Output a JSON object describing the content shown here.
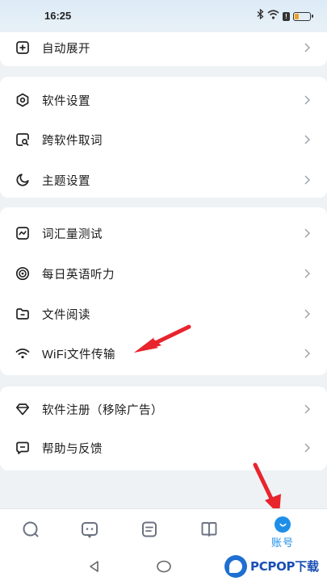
{
  "status_bar": {
    "time": "16:25",
    "icons": [
      "bluetooth-icon",
      "wifi-icon",
      "alert-icon",
      "battery-icon"
    ],
    "alert_glyph": "!",
    "battery_level": 0.25
  },
  "menu": {
    "group1": [
      {
        "label": "自动展开",
        "icon": "plus-square-icon"
      }
    ],
    "group2": [
      {
        "label": "软件设置",
        "icon": "hexagon-settings-icon"
      },
      {
        "label": "跨软件取词",
        "icon": "search-square-icon"
      },
      {
        "label": "主题设置",
        "icon": "moon-icon"
      }
    ],
    "group3": [
      {
        "label": "词汇量测试",
        "icon": "chart-square-icon"
      },
      {
        "label": "每日英语听力",
        "icon": "coin-circle-icon"
      },
      {
        "label": "文件阅读",
        "icon": "folder-icon"
      },
      {
        "label": "WiFi文件传输",
        "icon": "wifi-icon"
      }
    ],
    "group4": [
      {
        "label": "软件注册（移除广告）",
        "icon": "diamond-icon"
      },
      {
        "label": "帮助与反馈",
        "icon": "chat-bubble-icon"
      }
    ]
  },
  "bottom_nav": {
    "tabs": [
      {
        "name": "search",
        "icon": "search-icon"
      },
      {
        "name": "translate",
        "icon": "chat-square-icon"
      },
      {
        "name": "notes",
        "icon": "note-icon"
      },
      {
        "name": "book",
        "icon": "book-icon"
      },
      {
        "name": "account",
        "icon": "account-icon",
        "label": "账号",
        "active": true
      }
    ]
  },
  "watermark": {
    "text": "PCPOP下载"
  },
  "colors": {
    "accent": "#1e8fe8",
    "annotation_arrow": "#e8242c",
    "background": "#eef2f5",
    "card": "#ffffff"
  }
}
